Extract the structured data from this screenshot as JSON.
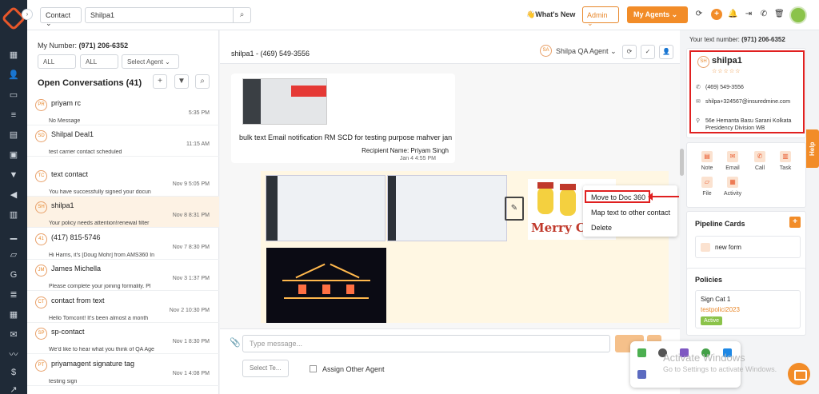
{
  "topbar": {
    "contact_type": "Contact",
    "search_value": "Shilpa1",
    "whats_new": "What's New",
    "admin": "Admin",
    "my_agents": "My Agents"
  },
  "conversations": {
    "my_number_label": "My Number:",
    "my_number": "(971) 206-6352",
    "filter1": "ALL",
    "filter2": "ALL",
    "select_agent_placeholder": "Select Agent",
    "title": "Open Conversations (41)",
    "items": [
      {
        "initials": "PR",
        "name": "priyam rc",
        "time": "5:35 PM",
        "preview": "No Message"
      },
      {
        "initials": "SD",
        "name": "Shilpal Deal1",
        "time": "11:15 AM",
        "preview": "test carrier contact scheduled"
      },
      {
        "initials": "TC",
        "name": "text contact",
        "time": "Nov 9 5:05 PM",
        "preview": "You have successfully signed your docun"
      },
      {
        "initials": "SH",
        "name": "shilpa1",
        "time": "Nov 8 8:31 PM",
        "preview": "Your policy needs attention!renewal filter"
      },
      {
        "initials": "41",
        "name": "(417) 815-5746",
        "time": "Nov 7 8:30 PM",
        "preview": "Hi Harris, it's [Doug Mohr] from AMS360 In"
      },
      {
        "initials": "JM",
        "name": "James Michella",
        "time": "Nov 3 1:37 PM",
        "preview": "Please complete your joining formality. Pl"
      },
      {
        "initials": "CT",
        "name": "contact from text",
        "time": "Nov 2 10:30 PM",
        "preview": "Hello Tomcont! It's been almost a month"
      },
      {
        "initials": "SP",
        "name": "sp-contact",
        "time": "Nov 1 8:30 PM",
        "preview": "We'd like to hear what you think of QA Age"
      },
      {
        "initials": "PT",
        "name": "priyamagent signature tag",
        "time": "Nov 1 4:08 PM",
        "preview": "testing sign"
      }
    ]
  },
  "chat": {
    "title": "shilpa1 - (469) 549-3556",
    "agent_initials": "SA",
    "agent_name": "Shilpa QA Agent",
    "message1_text": "bulk text Email notification RM SCD for testing purpose mahver jan",
    "message1_recipient": "Recipient Name: Priyam Singh",
    "message1_time": "Jan 4 4:55 PM",
    "xmas_text": "Merry C",
    "context_menu": [
      "Move to Doc 360",
      "Map text to other contact",
      "Delete"
    ],
    "type_placeholder": "Type message...",
    "select_template": "Select Te...",
    "assign_other": "Assign Other Agent"
  },
  "right": {
    "text_number_label": "Your text number:",
    "text_number": "(971) 206-6352",
    "contact_initials": "SH",
    "contact_name": "shilpa1",
    "phone": "(469) 549-3556",
    "email": "shilpa+324567@insuredmine.com",
    "address": "56e Hemanta Basu Sarani Kolkata Presidency Division WB",
    "actions": [
      "Note",
      "Email",
      "Call",
      "Task",
      "File",
      "Activity"
    ],
    "pipeline_title": "Pipeline Cards",
    "pipeline_item": "new form",
    "policies_title": "Policies",
    "policy_name": "Sign Cat 1",
    "policy_link": "testpolici2023",
    "policy_status": "Active"
  },
  "help_tab": "Help",
  "windows": {
    "activate_title": "Activate Windows",
    "activate_sub": "Go to Settings to activate Windows."
  }
}
